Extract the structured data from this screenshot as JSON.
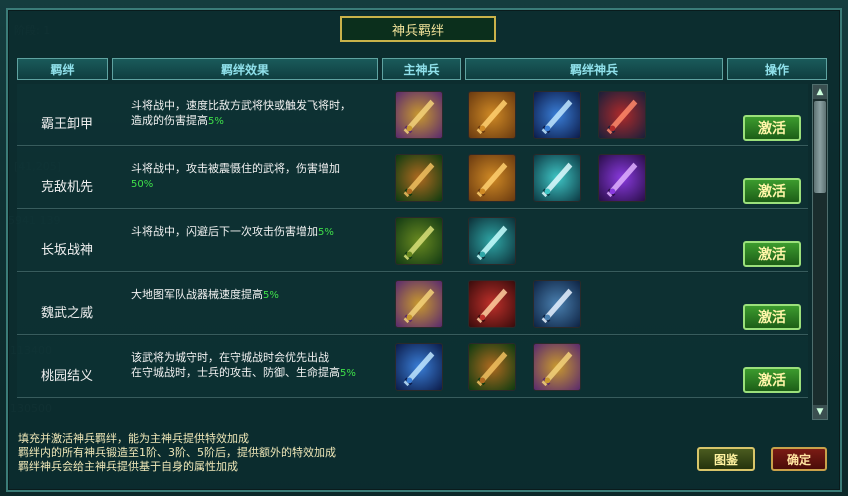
{
  "dialog": {
    "title": "神兵羁绊"
  },
  "headers": {
    "bond": "羁绊",
    "effect": "羁绊效果",
    "main_weapon": "主神兵",
    "bond_weapons": "羁绊神兵",
    "action": "操作"
  },
  "rows": [
    {
      "name": "霸王卸甲",
      "effect_lines": [
        "斗将战中，速度比敌方武将快或触发飞将时，",
        "造成的伤害提高"
      ],
      "pct": "5%",
      "icons": [
        "gold-blade-icon",
        "gold-axe-icon",
        "blue-sword-icon",
        "red-blade-icon"
      ],
      "action": "激活"
    },
    {
      "name": "克敌机先",
      "effect_lines": [
        "斗将战中，攻击被震慑住的武将，伤害增加",
        ""
      ],
      "pct": "50%",
      "icons": [
        "green-bow-icon",
        "gold-axe-icon",
        "cyan-crossbow-icon",
        "purple-bow-icon"
      ],
      "action": "激活"
    },
    {
      "name": "长坂战神",
      "effect_lines": [
        "斗将战中，闪避后下一次攻击伤害增加"
      ],
      "pct": "5%",
      "icons": [
        "green-spear-icon",
        "cyan-glaive-icon"
      ],
      "action": "激活"
    },
    {
      "name": "魏武之威",
      "effect_lines": [
        "大地图军队战器械速度提高"
      ],
      "pct": "5%",
      "icons": [
        "gold-blade-icon",
        "red-halberd-icon",
        "blue-greatsword-icon"
      ],
      "action": "激活"
    },
    {
      "name": "桃园结义",
      "effect_lines": [
        "该武将为城守时，在守城战时会优先出战",
        "在守城战时，士兵的攻击、防御、生命提高"
      ],
      "pct": "5%",
      "icons": [
        "blue-sword-icon",
        "green-bow-icon",
        "gold-blade-icon"
      ],
      "action": "激活"
    }
  ],
  "footer": {
    "lines": [
      "填充并激活神兵羁绊，能为主神兵提供特效加成",
      "羁绊内的所有神兵锻造至1阶、3阶、5阶后，提供额外的特效加成",
      "羁绊神兵会给主神兵提供基于自身的属性加成"
    ]
  },
  "buttons": {
    "atlas": "图鉴",
    "confirm": "确定"
  },
  "colors": {
    "accent_green": "#3fe04a",
    "header_text": "#8fe0ea",
    "title_border": "#c9b24a"
  }
}
